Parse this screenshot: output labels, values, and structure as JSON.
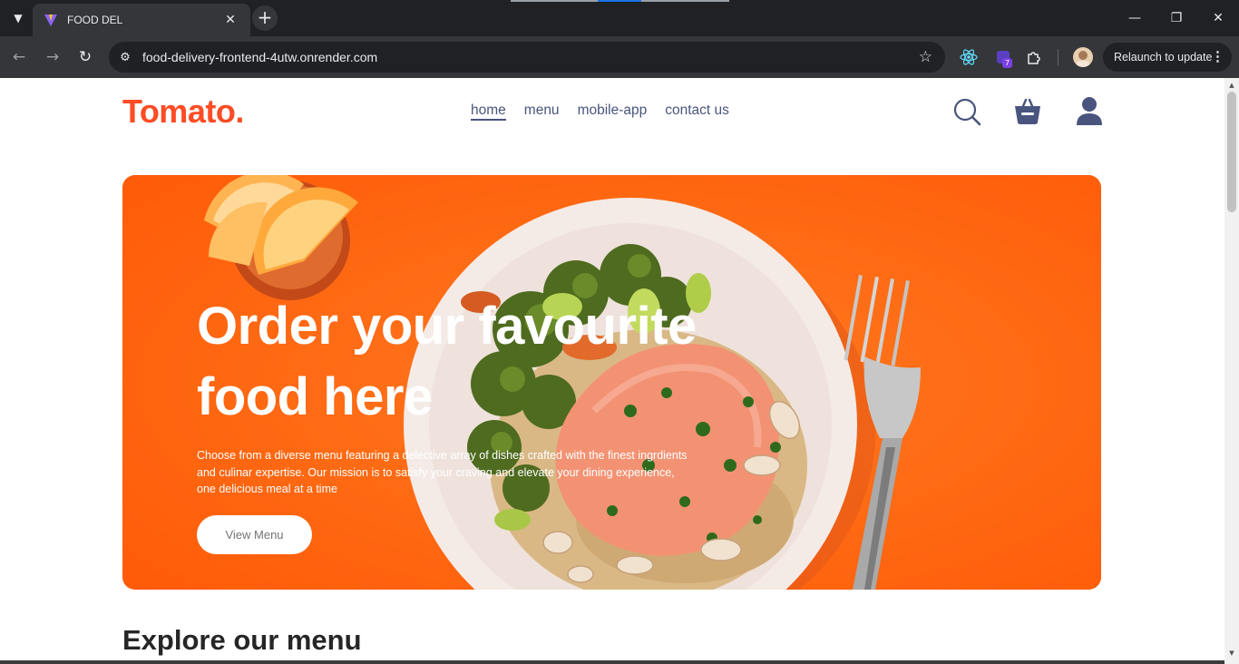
{
  "browser": {
    "tab_title": "FOOD DEL",
    "url": "food-delivery-frontend-4utw.onrender.com",
    "relaunch_label": "Relaunch to update",
    "extension_badge": "7"
  },
  "site": {
    "logo": "Tomato.",
    "nav": [
      "home",
      "menu",
      "mobile-app",
      "contact us"
    ],
    "active_nav": "home"
  },
  "hero": {
    "title": "Order your favourite food here",
    "description": "Choose from a diverse menu featuring a delective array of dishes crafted with the finest ingrdients and culinar expertise. Our mission is to satisfy your craving and elevate your dining experience, one delicious meal at a time",
    "button_label": "View Menu"
  },
  "section": {
    "explore_title": "Explore our menu"
  },
  "colors": {
    "brand": "#ff4c24",
    "hero_background": "#ff6a13",
    "nav_text": "#49557e"
  }
}
